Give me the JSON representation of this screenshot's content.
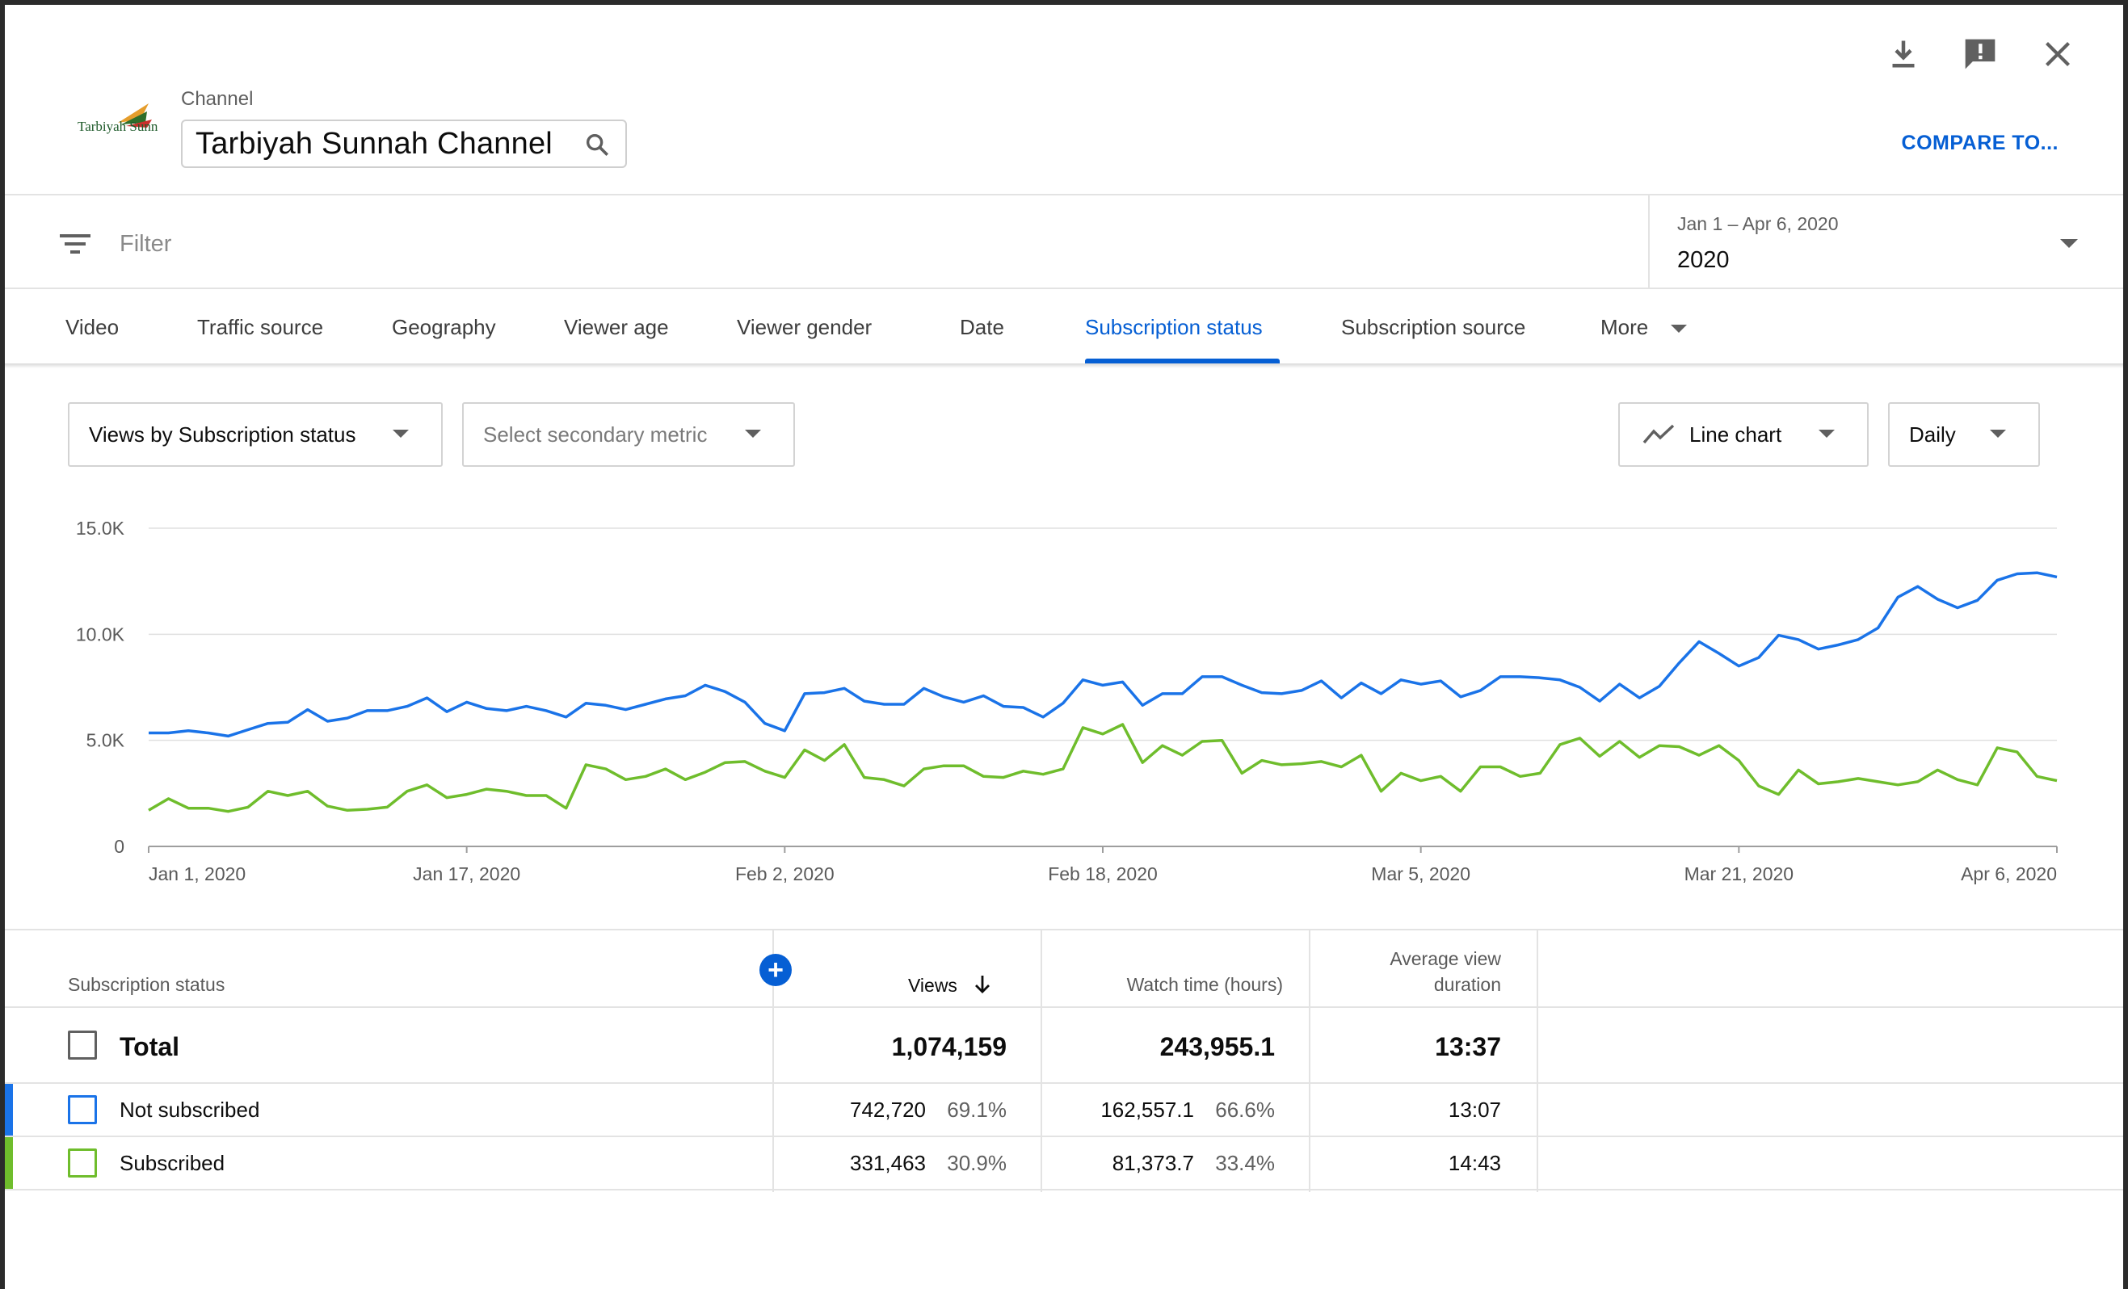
{
  "header": {
    "logo_text": "Tarbiyah Sunnah",
    "channel_caption": "Channel",
    "channel_name": "Tarbiyah Sunnah Channel",
    "compare_label": "COMPARE TO..."
  },
  "filter": {
    "placeholder": "Filter",
    "date_range": "Jan 1 – Apr 6, 2020",
    "date_preset": "2020"
  },
  "tabs": [
    {
      "label": "Video"
    },
    {
      "label": "Traffic source"
    },
    {
      "label": "Geography"
    },
    {
      "label": "Viewer age"
    },
    {
      "label": "Viewer gender"
    },
    {
      "label": "Date"
    },
    {
      "label": "Subscription status",
      "active": true
    },
    {
      "label": "Subscription source"
    },
    {
      "label": "More"
    }
  ],
  "controls": {
    "primary_metric": "Views by Subscription status",
    "secondary_metric": "Select secondary metric",
    "chart_type": "Line chart",
    "interval": "Daily"
  },
  "chart_data": {
    "type": "line",
    "ylim": [
      0,
      15000
    ],
    "y_ticks": [
      "0",
      "5.0K",
      "10.0K",
      "15.0K"
    ],
    "x_ticks": [
      "Jan 1, 2020",
      "Jan 17, 2020",
      "Feb 2, 2020",
      "Feb 18, 2020",
      "Mar 5, 2020",
      "Mar 21, 2020",
      "Apr 6, 2020"
    ],
    "x_start": "Jan 1, 2020",
    "x_end": "Apr 6, 2020",
    "grid": true,
    "series": [
      {
        "name": "Not subscribed",
        "color": "#1a73e8",
        "values": [
          5350,
          5350,
          5450,
          5350,
          5200,
          5500,
          5800,
          5850,
          6450,
          5900,
          6050,
          6400,
          6400,
          6600,
          7000,
          6350,
          6800,
          6500,
          6400,
          6600,
          6400,
          6100,
          6750,
          6650,
          6450,
          6700,
          6950,
          7100,
          7600,
          7300,
          6800,
          5800,
          5450,
          7200,
          7250,
          7450,
          6850,
          6700,
          6700,
          7450,
          7050,
          6800,
          7100,
          6600,
          6550,
          6100,
          6750,
          7850,
          7600,
          7750,
          6650,
          7200,
          7200,
          8000,
          8000,
          7600,
          7250,
          7200,
          7350,
          7800,
          7000,
          7700,
          7200,
          7850,
          7650,
          7800,
          7050,
          7350,
          8000,
          8000,
          7950,
          7850,
          7500,
          6850,
          7650,
          7000,
          7550,
          8650,
          9650,
          9100,
          8500,
          8900,
          9950,
          9750,
          9300,
          9500,
          9750,
          10300,
          11750,
          12250,
          11650,
          11250,
          11600,
          12550,
          12850,
          12900,
          12700
        ]
      },
      {
        "name": "Subscribed",
        "color": "#6fbd2c",
        "values": [
          1700,
          2250,
          1800,
          1800,
          1650,
          1850,
          2600,
          2400,
          2600,
          1900,
          1700,
          1750,
          1850,
          2600,
          2900,
          2300,
          2450,
          2700,
          2600,
          2400,
          2400,
          1800,
          3850,
          3650,
          3150,
          3300,
          3650,
          3150,
          3500,
          3950,
          4000,
          3550,
          3250,
          4550,
          4050,
          4800,
          3250,
          3150,
          2850,
          3650,
          3800,
          3800,
          3300,
          3250,
          3550,
          3400,
          3650,
          5600,
          5300,
          5750,
          3950,
          4750,
          4300,
          4950,
          5000,
          3450,
          4050,
          3850,
          3900,
          4000,
          3750,
          4300,
          2600,
          3450,
          3100,
          3300,
          2600,
          3750,
          3750,
          3300,
          3450,
          4800,
          5100,
          4250,
          4950,
          4200,
          4750,
          4700,
          4300,
          4750,
          4050,
          2850,
          2450,
          3600,
          2950,
          3050,
          3200,
          3050,
          2900,
          3050,
          3600,
          3150,
          2900,
          4650,
          4450,
          3300,
          3100
        ]
      }
    ]
  },
  "table": {
    "headers": {
      "dimension": "Subscription status",
      "views": "Views",
      "watch_time": "Watch time (hours)",
      "avd_line1": "Average view",
      "avd_line2": "duration"
    },
    "total": {
      "label": "Total",
      "views": "1,074,159",
      "watch_time": "243,955.1",
      "avd": "13:37"
    },
    "rows": [
      {
        "label": "Not subscribed",
        "color": "#1a73e8",
        "views": "742,720",
        "views_pct": "69.1%",
        "watch_time": "162,557.1",
        "watch_pct": "66.6%",
        "avd": "13:07"
      },
      {
        "label": "Subscribed",
        "color": "#6fbd2c",
        "views": "331,463",
        "views_pct": "30.9%",
        "watch_time": "81,373.7",
        "watch_pct": "33.4%",
        "avd": "14:43"
      }
    ]
  }
}
